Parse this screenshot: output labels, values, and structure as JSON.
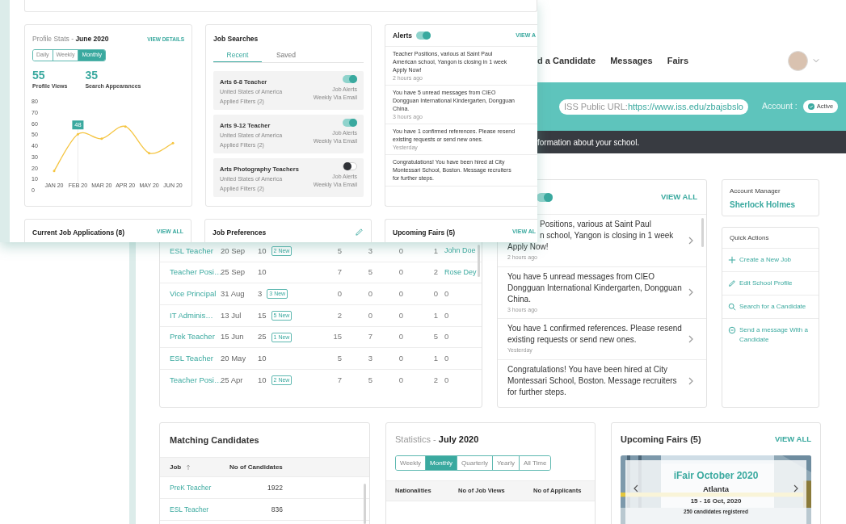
{
  "front_window": {
    "profile_stats": {
      "title": "Profile Stats - ",
      "period": "June 2020",
      "link": "VIEW DETAILS",
      "ranges": [
        {
          "label": "Daily",
          "selected": false
        },
        {
          "label": "Weekly",
          "selected": false
        },
        {
          "label": "Monthly",
          "selected": true
        }
      ],
      "stats": [
        {
          "value": "55",
          "label": "Profile Views"
        },
        {
          "value": "35",
          "label": "Search Appearances"
        }
      ],
      "chart_data": {
        "type": "line",
        "categories": [
          "JAN 20",
          "FEB 20",
          "MAR 20",
          "APR 20",
          "MAY 20",
          "JUN 20"
        ],
        "series": [
          {
            "color": "#f5c542",
            "values": [
              17,
              50,
              46,
              57,
              33,
              42
            ]
          }
        ],
        "ylim": [
          0,
          80
        ],
        "yticks": [
          0,
          10,
          20,
          30,
          40,
          50,
          60,
          70,
          80
        ],
        "annotations": [
          {
            "x": "FEB 20",
            "y": 50,
            "text": "48"
          }
        ]
      }
    },
    "job_searches": {
      "title": "Job Searches",
      "tabs": [
        {
          "label": "Recent",
          "selected": true
        },
        {
          "label": "Saved",
          "selected": false
        }
      ],
      "items": [
        {
          "title": "Arts 6-8 Teacher",
          "country": "United States of America",
          "filters": "Applied Filters (2)",
          "alerts": "Job Alerts",
          "frequency": "Weekly Via Email",
          "on": true
        },
        {
          "title": "Arts 9-12 Teacher",
          "country": "United States of America",
          "filters": "Applied Filters (2)",
          "alerts": "Job Alerts",
          "frequency": "Weekly Via Email",
          "on": true
        },
        {
          "title": "Arts Photography Teachers",
          "country": "United States of America",
          "filters": "Applied Filters (2)",
          "alerts": "Job Alerts",
          "frequency": "Weekly Via Email",
          "on": false
        }
      ]
    },
    "alerts": {
      "title": "Alerts",
      "on": true,
      "link": "VIEW A",
      "items": [
        {
          "lines": [
            "Teacher Positions, various at Saint Paul",
            "American school, Yangon is closing in 1 week",
            "Apply Now!"
          ],
          "time": "2 hours ago"
        },
        {
          "lines": [
            "You have 5 unread messages from CIEO",
            "Dongguan International Kindergarten, Dongguan",
            "China."
          ],
          "time": "3 hours ago"
        },
        {
          "lines": [
            "You have 1 confirmed references. Please resend",
            "existing requests or send new ones."
          ],
          "time": "Yesterday"
        },
        {
          "lines": [
            "Congratulations! You have been hired at City",
            "Montessari School, Boston. Message recruiters",
            "for further steps."
          ]
        }
      ]
    },
    "bottom_cards": [
      {
        "title": "Current Job Applications (8)",
        "link": "VIEW ALL",
        "editable": false
      },
      {
        "title": "Job Preferences",
        "editable": true
      },
      {
        "title": "Upcoming Fairs (5)",
        "link": "VIEW AL",
        "editable": false
      }
    ]
  },
  "back_window": {
    "nav": [
      "d a Candidate",
      "Messages",
      "Fairs"
    ],
    "banner": {
      "url_label": "ISS Public URL: ",
      "url": "https://www.iss.edu/zbajsbslo",
      "account_label": "Account :",
      "status": "Active"
    },
    "notice": "formation about your school.",
    "applications": [
      {
        "job": "ESL Teacher",
        "date": "20 Sep",
        "count": "10",
        "badge": "2 New",
        "c4": "5",
        "c5": "3",
        "c6": "0",
        "c7": "1",
        "last": {
          "text": "John Doe",
          "link": true
        }
      },
      {
        "job": "Teacher Posi…",
        "date": "25 Sep",
        "count": "10",
        "c4": "7",
        "c5": "5",
        "c6": "0",
        "c7": "2",
        "last": {
          "text": "Rose Dey",
          "link": true
        }
      },
      {
        "job": "Vice Principal",
        "date": "31 Aug",
        "count": "3",
        "badge": "3 New",
        "c4": "0",
        "c5": "0",
        "c6": "0",
        "c7": "0",
        "last": {
          "text": "0",
          "link": false
        }
      },
      {
        "job": "IT Adminis…",
        "date": "13 Jul",
        "count": "15",
        "badge": "5 New",
        "c4": "2",
        "c5": "0",
        "c6": "0",
        "c7": "1",
        "last": {
          "text": "0",
          "link": false
        }
      },
      {
        "job": "Prek Teacher",
        "date": "15 Jun",
        "count": "25",
        "badge": "1 New",
        "c4": "15",
        "c5": "7",
        "c6": "0",
        "c7": "5",
        "last": {
          "text": "0",
          "link": false
        }
      },
      {
        "job": "ESL Teacher",
        "date": "20 May",
        "count": "10",
        "c4": "5",
        "c5": "3",
        "c6": "0",
        "c7": "1",
        "last": {
          "text": "0",
          "link": false
        }
      },
      {
        "job": "Teacher Posi…",
        "date": "25 Apr",
        "count": "10",
        "badge": "2 New",
        "c4": "7",
        "c5": "5",
        "c6": "0",
        "c7": "2",
        "last": {
          "text": "0",
          "link": false
        }
      }
    ],
    "alerts": {
      "on": true,
      "link": "VIEW ALL",
      "items": [
        {
          "lines": [
            {
              "text": "Positions, various at Saint Paul",
              "covered": true
            },
            {
              "text": "n school, Yangon is closing in 1 week",
              "covered": true
            },
            {
              "text": "Apply Now!"
            }
          ],
          "time": "2 hours ago"
        },
        {
          "lines": [
            {
              "text": "You have 5 unread messages from CIEO"
            },
            {
              "text": "Dongguan International Kindergarten, Dongguan"
            },
            {
              "text": "China."
            }
          ],
          "time": "3 hours ago"
        },
        {
          "lines": [
            {
              "text": "You have 1 confirmed references. Please resend"
            },
            {
              "text": "existing requests or send new ones."
            }
          ],
          "time": "Yesterday"
        },
        {
          "lines": [
            {
              "text": "Congratulations! You have been hired at City"
            },
            {
              "text": "Montessari School, Boston. Message recruiters"
            },
            {
              "text": "for further steps."
            }
          ]
        }
      ]
    },
    "account_manager": {
      "label": "Account Manager",
      "name": "Sherlock Holmes"
    },
    "quick_actions": {
      "title": "Quick Actions",
      "items": [
        "Create a New Job",
        "Edit School Profile",
        "Search for a Candidate",
        "Send a message With a Candidate"
      ]
    },
    "matching": {
      "title": "Matching Candidates",
      "columns": [
        "Job",
        "No of Candidates"
      ],
      "rows": [
        [
          "PreK Teacher",
          "1922"
        ],
        [
          "ESL Teacher",
          "836"
        ]
      ]
    },
    "statistics": {
      "title": "Statistics - ",
      "period": "July 2020",
      "ranges": [
        {
          "label": "Weekly",
          "selected": false
        },
        {
          "label": "Monthly",
          "selected": true
        },
        {
          "label": "Quarterly",
          "selected": false
        },
        {
          "label": "Yearly",
          "selected": false
        },
        {
          "label": "All Time",
          "selected": false
        }
      ],
      "columns": [
        "Nationalities",
        "No of Job Views",
        "No of Applicants"
      ]
    },
    "fairs": {
      "title": "Upcoming Fairs (5)",
      "link": "VIEW ALL",
      "fair": {
        "name": "iFair October 2020",
        "city": "Atlanta",
        "dates": "15 - 16 Oct, 2020",
        "registered": "250 candidates registered"
      }
    }
  }
}
